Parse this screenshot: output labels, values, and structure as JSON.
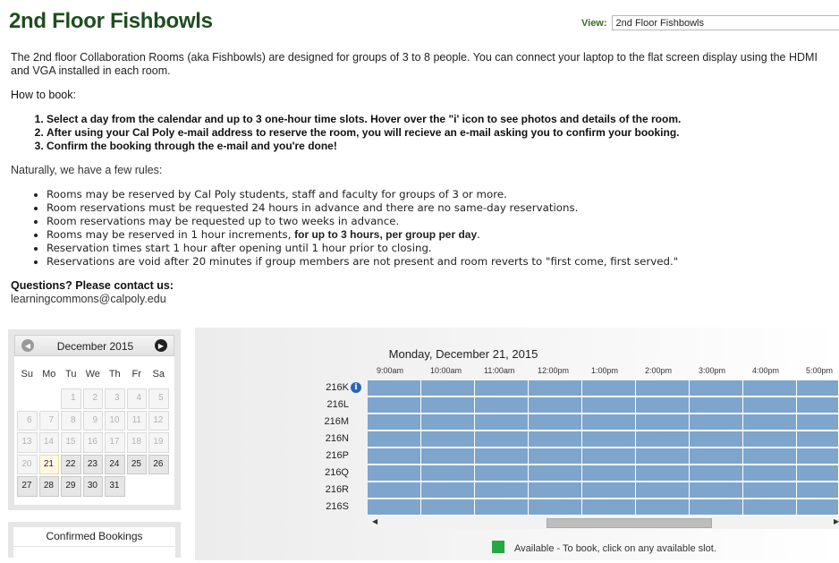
{
  "page": {
    "title": "2nd Floor Fishbowls",
    "view_label": "View:",
    "view_selected": "2nd Floor Fishbowls",
    "intro": "The 2nd floor Collaboration Rooms (aka Fishbowls) are designed for groups of 3 to 8 people. You can connect your laptop to the flat screen display using the HDMI and VGA installed in each room.",
    "howto_heading": "How to book:",
    "steps": [
      "Select a day from the calendar and up to 3 one-hour time slots. Hover over the \"i' icon to see photos and details of the room.",
      "After using your Cal Poly e-mail address to reserve the room, you will recieve an e-mail asking you to confirm your booking.",
      "Confirm the booking through the e-mail and you're done!"
    ],
    "rules_intro": "Naturally, we have a few rules:",
    "rules": [
      {
        "text": "Rooms may be reserved by Cal Poly students, staff and faculty for groups of 3 or more."
      },
      {
        "text": "Room reservations must be requested 24 hours in advance and there are no same-day reservations."
      },
      {
        "text": "Room reservations may be requested up to two weeks in advance."
      },
      {
        "text": "Rooms may be reserved in 1 hour increments, ",
        "bold": "for up to 3 hours, per group per day",
        "tail": "."
      },
      {
        "text": "Reservation times start 1 hour after opening until 1 hour prior to closing."
      },
      {
        "text": "Reservations are void after 20 minutes if group members are not present and room reverts to \"first come, first served.\""
      }
    ],
    "questions": "Questions? Please contact us:",
    "contact": "learningcommons@calpoly.edu"
  },
  "calendar": {
    "month": "December 2015",
    "prev_icon": "chevron-left-icon",
    "next_icon": "chevron-right-icon",
    "weekdays": [
      "Su",
      "Mo",
      "Tu",
      "We",
      "Th",
      "Fr",
      "Sa"
    ],
    "weeks": [
      [
        "",
        "",
        "1",
        "2",
        "3",
        "4",
        "5"
      ],
      [
        "6",
        "7",
        "8",
        "9",
        "10",
        "11",
        "12"
      ],
      [
        "13",
        "14",
        "15",
        "16",
        "17",
        "18",
        "19"
      ],
      [
        "20",
        "21",
        "22",
        "23",
        "24",
        "25",
        "26"
      ],
      [
        "27",
        "28",
        "29",
        "30",
        "31",
        "",
        ""
      ]
    ],
    "today": "21",
    "first_available": "21"
  },
  "bookings": {
    "title": "Confirmed Bookings"
  },
  "schedule": {
    "date": "Monday, December 21, 2015",
    "times": [
      "9:00am",
      "10:00am",
      "11:00am",
      "12:00pm",
      "1:00pm",
      "2:00pm",
      "3:00pm",
      "4:00pm",
      "5:00pm"
    ],
    "rooms": [
      "216K",
      "216L",
      "216M",
      "216N",
      "216P",
      "216Q",
      "216R",
      "216S"
    ],
    "slot_color": "#7ea5cb",
    "legend_color": "#28a745",
    "legend_text": "Available - To book, click on any available slot."
  }
}
